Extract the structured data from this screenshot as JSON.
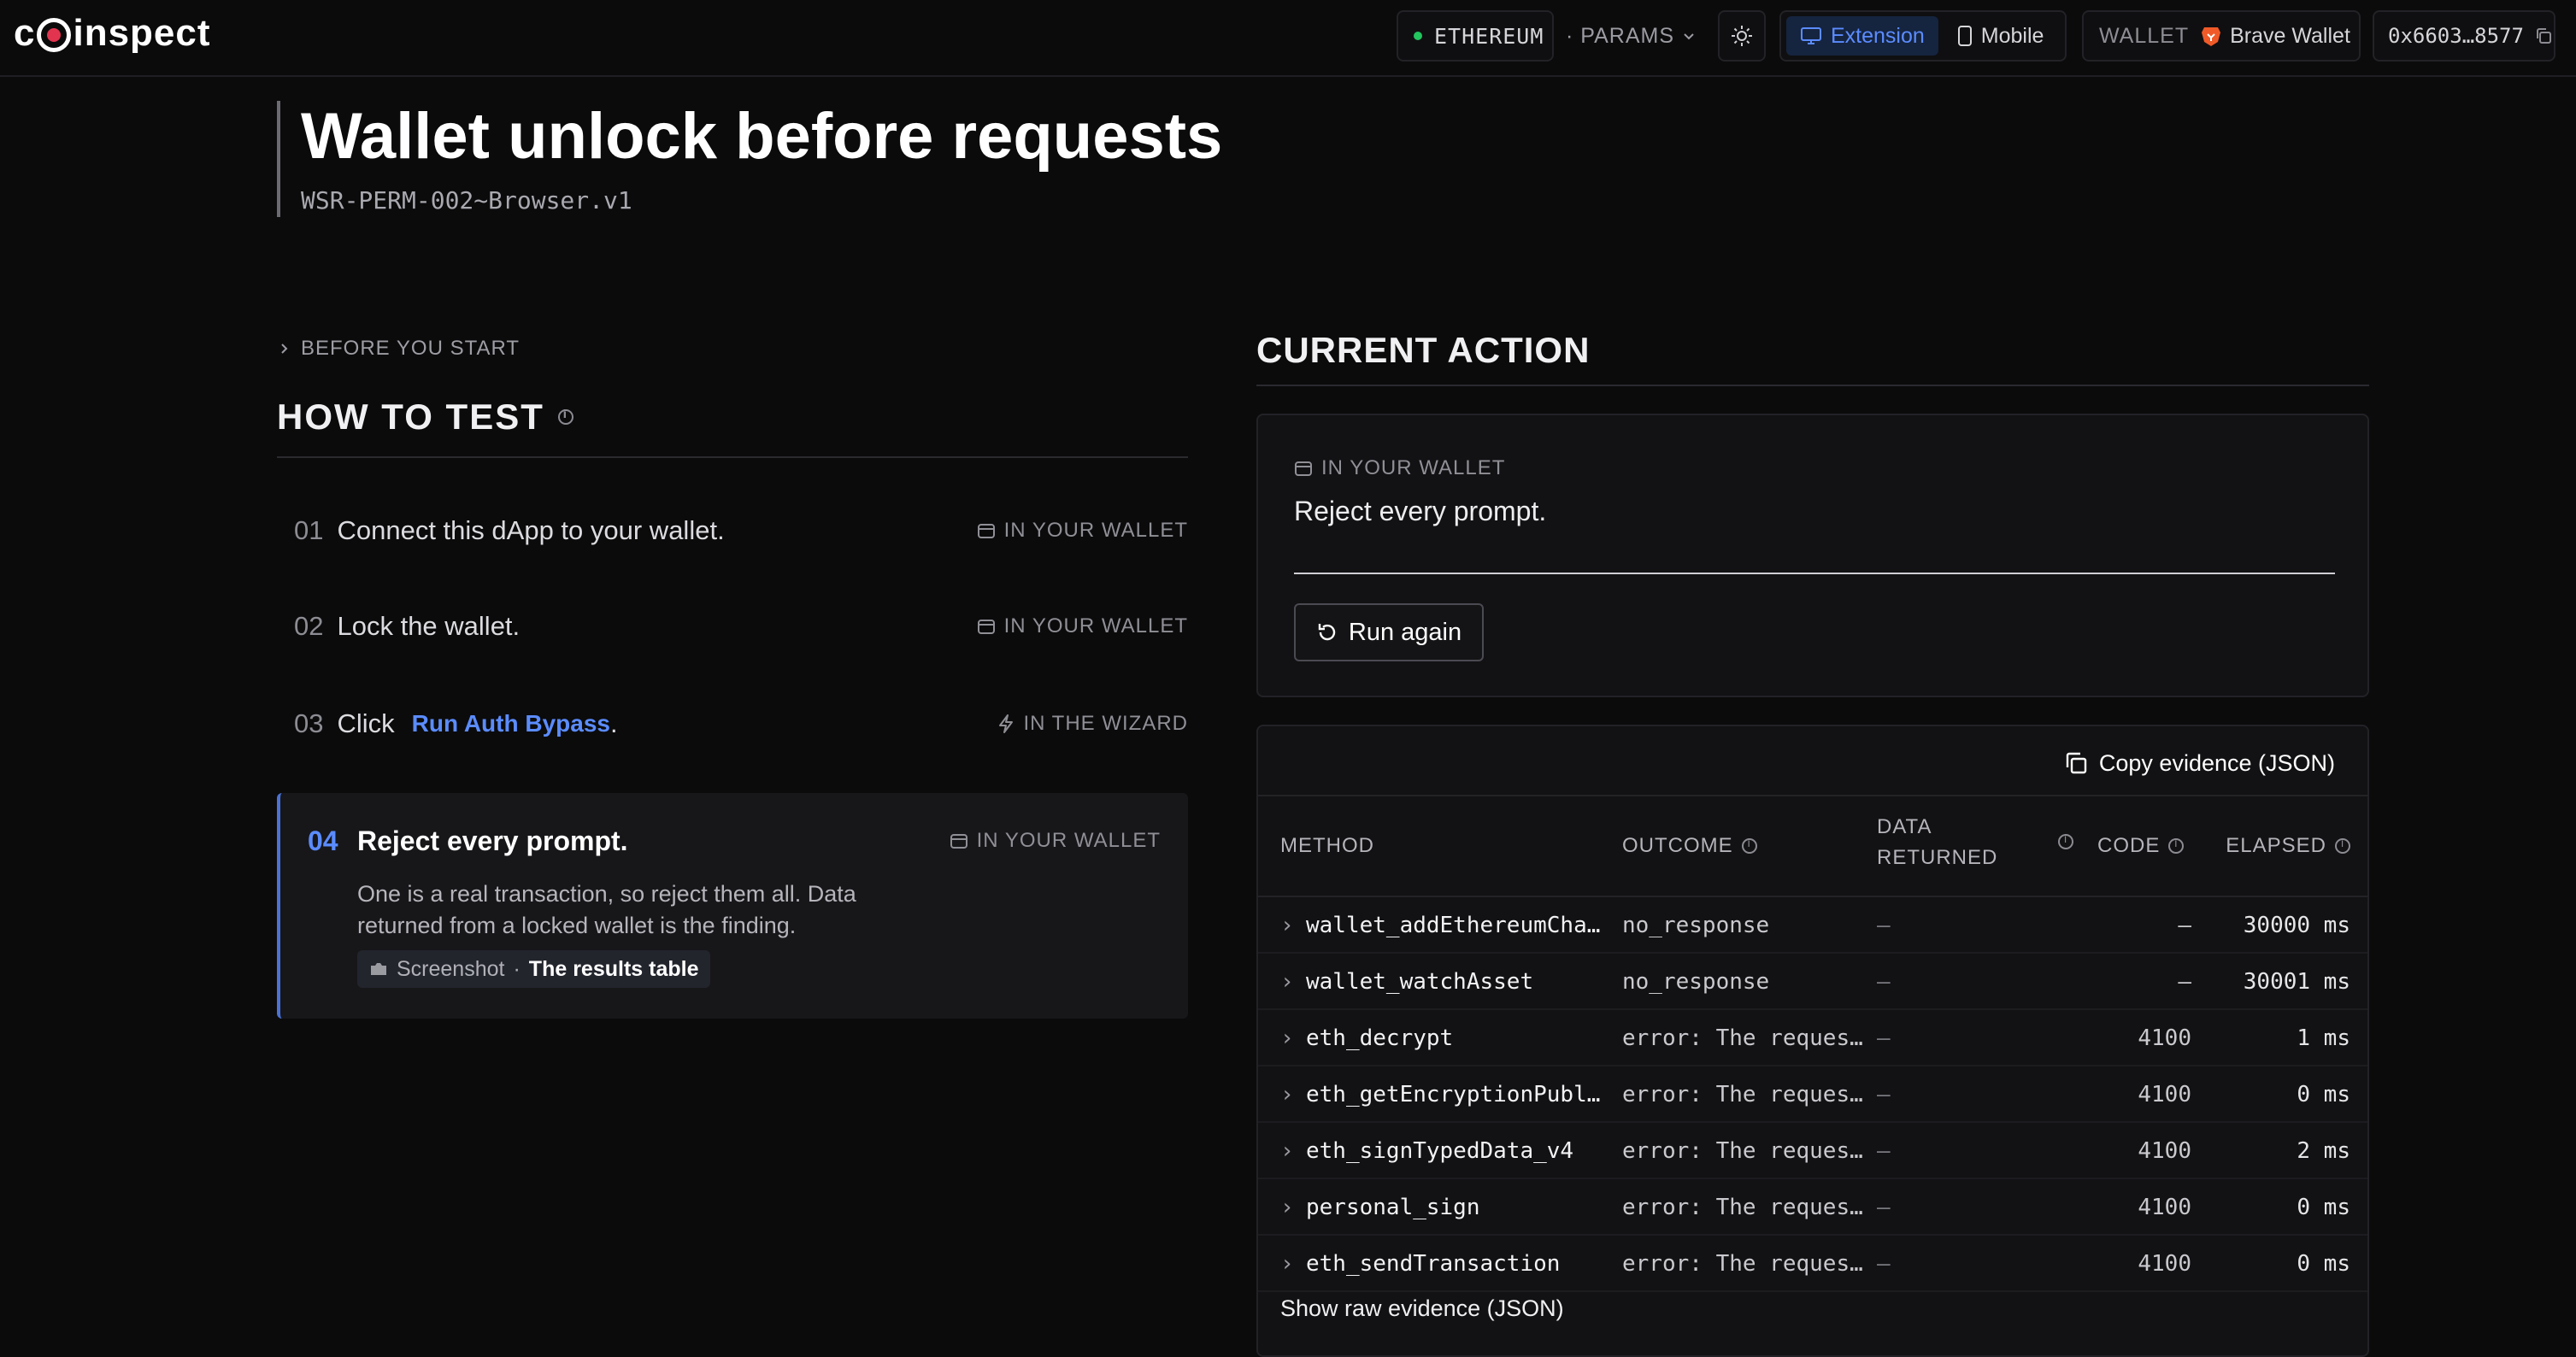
{
  "header": {
    "logo": "coinspect",
    "network": "ETHEREUM",
    "params_label": "· PARAMS",
    "mode_extension": "Extension",
    "mode_mobile": "Mobile",
    "wallet_label": "WALLET",
    "wallet_name": "Brave Wallet",
    "account": "0x6603…8577"
  },
  "test": {
    "title": "Wallet unlock before requests",
    "code": "WSR-PERM-002~Browser.v1"
  },
  "how_to": {
    "before_label": "BEFORE YOU START",
    "title": "HOW TO TEST",
    "steps": [
      {
        "num": "01",
        "text": "Connect this dApp to your wallet.",
        "tag": "IN YOUR WALLET"
      },
      {
        "num": "02",
        "text": "Lock the wallet.",
        "tag": "IN YOUR WALLET"
      },
      {
        "num": "03",
        "text": "Click",
        "link": "Run Auth Bypass",
        "suffix": ".",
        "tag": "IN THE WIZARD"
      },
      {
        "num": "04",
        "text": "Reject every prompt.",
        "tag": "IN YOUR WALLET",
        "desc": "One is a real transaction, so reject them all. Data returned from a locked wallet is the finding.",
        "chip_label": "Screenshot",
        "chip_sep": "·",
        "chip_value": "The results table"
      }
    ]
  },
  "current_action": {
    "title": "CURRENT ACTION",
    "tag": "IN YOUR WALLET",
    "prompt": "Reject every prompt.",
    "run_again": "Run again"
  },
  "evidence": {
    "copy_label": "Copy evidence (JSON)",
    "columns": {
      "method": "METHOD",
      "outcome": "OUTCOME",
      "data_line1": "DATA",
      "data_line2": "RETURNED",
      "code": "CODE",
      "elapsed": "ELAPSED"
    },
    "rows": [
      {
        "method": "wallet_addEthereumCha…",
        "outcome": "no_response",
        "data": "—",
        "code": "—",
        "elapsed": "30000 ms"
      },
      {
        "method": "wallet_watchAsset",
        "outcome": "no_response",
        "data": "—",
        "code": "—",
        "elapsed": "30001 ms"
      },
      {
        "method": "eth_decrypt",
        "outcome": "error: The reques…",
        "data": "—",
        "code": "4100",
        "elapsed": "1 ms"
      },
      {
        "method": "eth_getEncryptionPubl…",
        "outcome": "error: The reques…",
        "data": "—",
        "code": "4100",
        "elapsed": "0 ms"
      },
      {
        "method": "eth_signTypedData_v4",
        "outcome": "error: The reques…",
        "data": "—",
        "code": "4100",
        "elapsed": "2 ms"
      },
      {
        "method": "personal_sign",
        "outcome": "error: The reques…",
        "data": "—",
        "code": "4100",
        "elapsed": "0 ms"
      },
      {
        "method": "eth_sendTransaction",
        "outcome": "error: The reques…",
        "data": "—",
        "code": "4100",
        "elapsed": "0 ms"
      }
    ],
    "raw_label": "Show raw evidence (JSON)"
  },
  "colors": {
    "accent": "#5b8cff",
    "status_dot": "#22c55e",
    "brave": "#f05a28"
  }
}
